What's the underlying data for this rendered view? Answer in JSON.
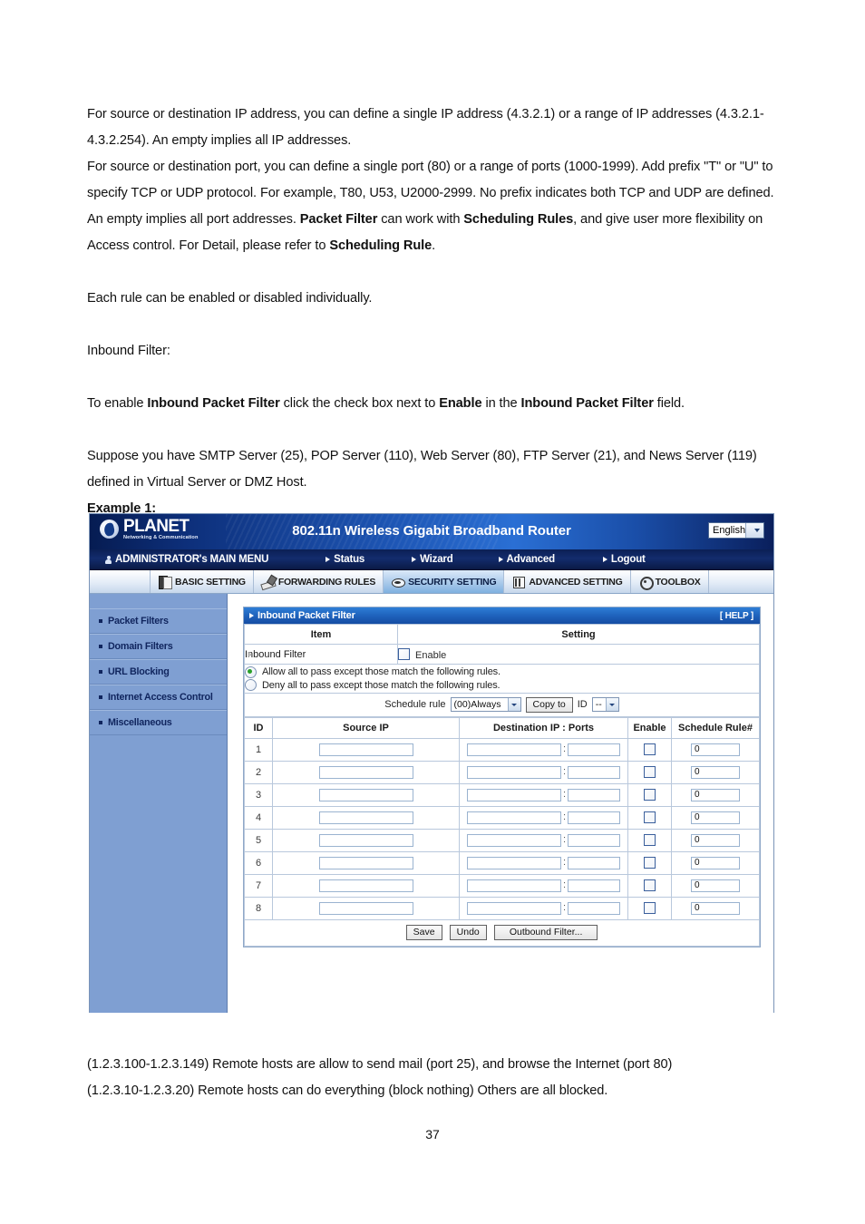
{
  "document": {
    "paragraphs": [
      {
        "id": "p1",
        "runs": [
          {
            "t": "For source or destination IP address, you can define a single IP address (4.3.2.1) or a range of IP addresses (4.3.2.1-4.3.2.254). An empty implies all IP addresses.",
            "b": false
          }
        ]
      },
      {
        "id": "p2",
        "runs": [
          {
            "t": "For source or destination port, you can define a single port (80) or a range of ports (1000-1999). Add prefix \"T\" or \"U\" to specify TCP or UDP protocol. For example, T80, U53, U2000-2999. No prefix indicates both TCP and UDP are defined. An empty implies all port addresses. ",
            "b": false
          },
          {
            "t": "Packet Filter",
            "b": true
          },
          {
            "t": " can work with ",
            "b": false
          },
          {
            "t": "Scheduling Rules",
            "b": true
          },
          {
            "t": ", and give user more flexibility on Access control. For Detail, please refer to ",
            "b": false
          },
          {
            "t": "Scheduling Rule",
            "b": true
          },
          {
            "t": ".",
            "b": false
          }
        ]
      },
      {
        "id": "p3",
        "runs": [
          {
            "t": "Each rule can be enabled or disabled individually.",
            "b": false
          }
        ]
      },
      {
        "id": "p4",
        "runs": [
          {
            "t": "Inbound Filter:",
            "b": false
          }
        ]
      },
      {
        "id": "p5",
        "runs": [
          {
            "t": "To enable ",
            "b": false
          },
          {
            "t": "Inbound Packet Filter",
            "b": true
          },
          {
            "t": " click the check box next to ",
            "b": false
          },
          {
            "t": "Enable",
            "b": true
          },
          {
            "t": " in the ",
            "b": false
          },
          {
            "t": "Inbound Packet Filter",
            "b": true
          },
          {
            "t": " field.",
            "b": false
          }
        ]
      },
      {
        "id": "p6",
        "runs": [
          {
            "t": "Suppose you have SMTP Server (25), POP Server (110), Web Server (80), FTP Server (21), and News Server (119) defined in Virtual Server or DMZ Host.",
            "b": false
          }
        ]
      },
      {
        "id": "p7",
        "runs": [
          {
            "t": "Example 1:",
            "b": true
          }
        ]
      }
    ],
    "footer_paragraphs": [
      {
        "id": "f1",
        "runs": [
          {
            "t": "(1.2.3.100-1.2.3.149) Remote hosts are allow to send mail (port 25), and browse the Internet (port 80)",
            "b": false
          }
        ]
      },
      {
        "id": "f2",
        "runs": [
          {
            "t": "(1.2.3.10-1.2.3.20) Remote hosts can do everything (block nothing) Others are all blocked.",
            "b": false
          }
        ]
      }
    ],
    "page_number": "37"
  },
  "router_ui": {
    "banner": {
      "logo_name": "PLANET",
      "logo_tagline": "Networking & Communication",
      "logo_icon": "globe-icon",
      "product_title": "802.11n Wireless Gigabit Broadband Router",
      "language": {
        "selected": "English",
        "options": [
          "English"
        ]
      }
    },
    "main_menu": {
      "admin_label": "ADMINISTRATOR's MAIN MENU",
      "items": [
        {
          "label": "Status"
        },
        {
          "label": "Wizard"
        },
        {
          "label": "Advanced"
        },
        {
          "label": "Logout"
        }
      ]
    },
    "tabs": [
      {
        "label": "BASIC SETTING",
        "icon": "book-icon",
        "active": false
      },
      {
        "label": "FORWARDING RULES",
        "icon": "pencil-icon",
        "active": false
      },
      {
        "label": "SECURITY SETTING",
        "icon": "security-icon",
        "active": true
      },
      {
        "label": "ADVANCED SETTING",
        "icon": "tower-icon",
        "active": false
      },
      {
        "label": "TOOLBOX",
        "icon": "gear-icon",
        "active": false
      }
    ],
    "sidebar": {
      "items": [
        {
          "label": "Packet Filters"
        },
        {
          "label": "Domain Filters"
        },
        {
          "label": "URL Blocking"
        },
        {
          "label": "Internet Access Control"
        },
        {
          "label": "Miscellaneous"
        }
      ]
    },
    "panel": {
      "title": "Inbound Packet Filter",
      "help_label": "[ HELP ]",
      "col_item": "Item",
      "col_setting": "Setting",
      "inbound_filter_label": "Inbound Filter",
      "enable_label": "Enable",
      "enable_checked": false,
      "policy": {
        "allow_label": "Allow all to pass except those match the following rules.",
        "deny_label": "Deny all to pass except those match the following rules.",
        "selected": "allow"
      },
      "schedule": {
        "label": "Schedule rule",
        "rule_selected": "(00)Always",
        "rule_options": [
          "(00)Always"
        ],
        "copy_to_label": "Copy to",
        "id_label": "ID",
        "id_selected": "--",
        "id_options": [
          "--"
        ]
      },
      "table": {
        "headers": [
          "ID",
          "Source IP",
          "Destination IP : Ports",
          "Enable",
          "Schedule Rule#"
        ],
        "rows": [
          {
            "id": "1",
            "source_ip": "",
            "dest_ip": "",
            "dest_port": "",
            "enable": false,
            "schedule_rule": "0"
          },
          {
            "id": "2",
            "source_ip": "",
            "dest_ip": "",
            "dest_port": "",
            "enable": false,
            "schedule_rule": "0"
          },
          {
            "id": "3",
            "source_ip": "",
            "dest_ip": "",
            "dest_port": "",
            "enable": false,
            "schedule_rule": "0"
          },
          {
            "id": "4",
            "source_ip": "",
            "dest_ip": "",
            "dest_port": "",
            "enable": false,
            "schedule_rule": "0"
          },
          {
            "id": "5",
            "source_ip": "",
            "dest_ip": "",
            "dest_port": "",
            "enable": false,
            "schedule_rule": "0"
          },
          {
            "id": "6",
            "source_ip": "",
            "dest_ip": "",
            "dest_port": "",
            "enable": false,
            "schedule_rule": "0"
          },
          {
            "id": "7",
            "source_ip": "",
            "dest_ip": "",
            "dest_port": "",
            "enable": false,
            "schedule_rule": "0"
          },
          {
            "id": "8",
            "source_ip": "",
            "dest_ip": "",
            "dest_port": "",
            "enable": false,
            "schedule_rule": "0"
          }
        ]
      },
      "buttons": [
        {
          "label": "Save",
          "name": "save-button"
        },
        {
          "label": "Undo",
          "name": "undo-button"
        },
        {
          "label": "Outbound Filter...",
          "name": "outbound-filter-button"
        }
      ]
    }
  },
  "colors": {
    "banner_blue": "#1d55b4",
    "menu_navy": "#0b1f55",
    "sidebar_blue": "#7f9fd2",
    "panel_header_blue": "#1f63bd",
    "active_tab_blue": "#a9c9ea",
    "radio_green": "#2aa02a"
  }
}
